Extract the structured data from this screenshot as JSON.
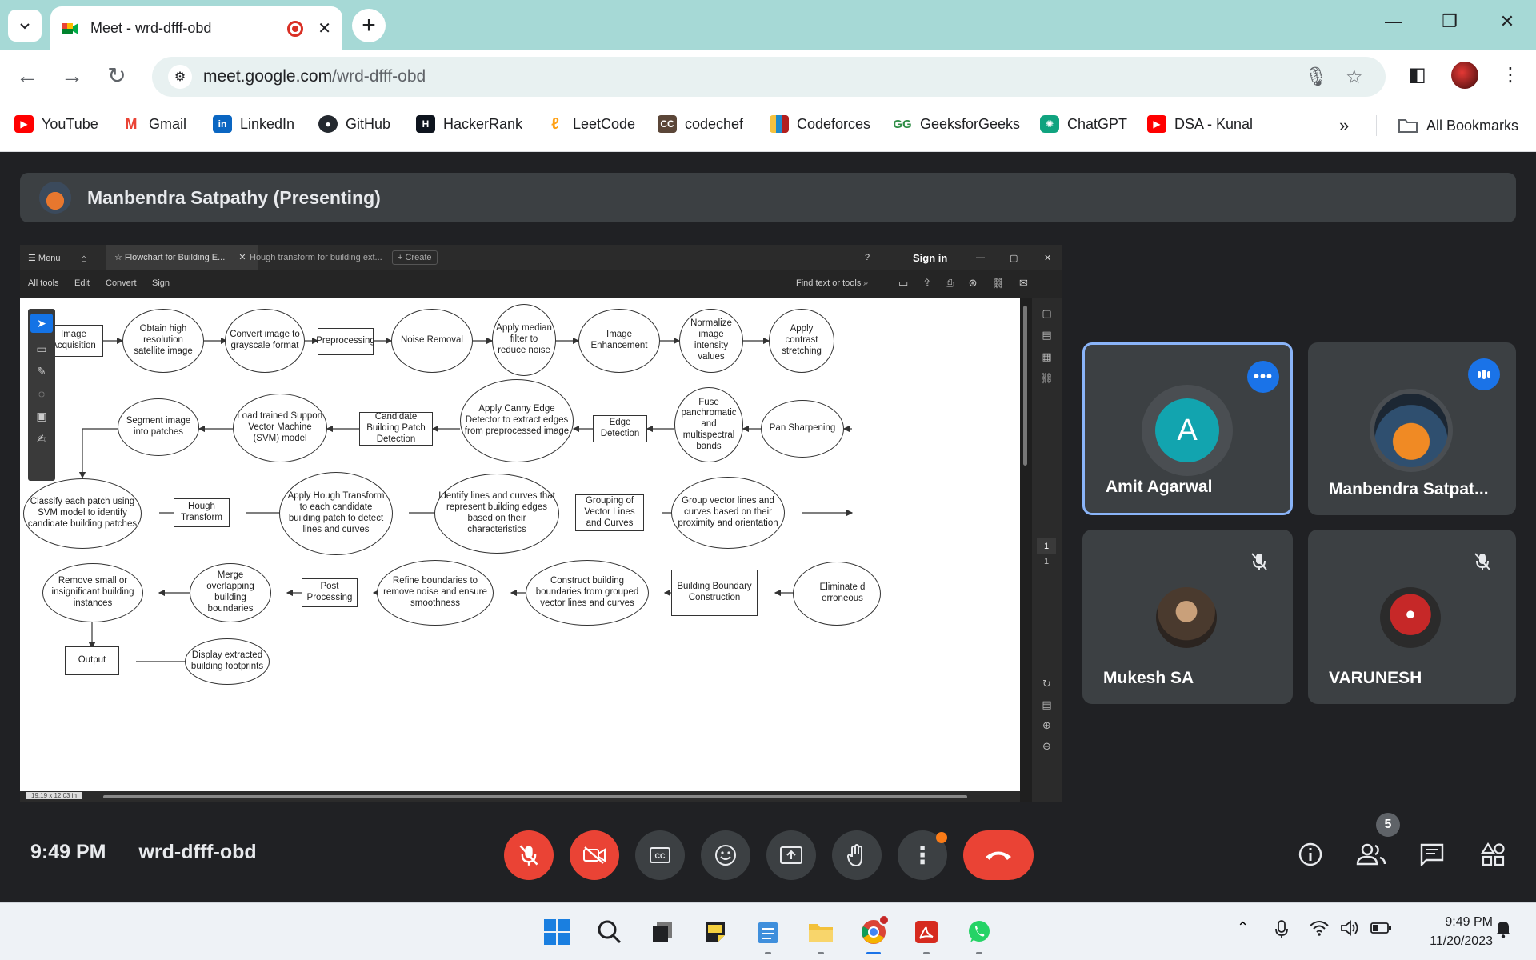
{
  "browser": {
    "tab_title": "Meet - wrd-dfff-obd",
    "url_host": "meet.google.com",
    "url_path": "/wrd-dfff-obd",
    "bookmarks": [
      {
        "label": "YouTube",
        "color": "#ff0000",
        "icon": "youtube-icon"
      },
      {
        "label": "Gmail",
        "color": "#ea4335",
        "icon": "gmail-icon"
      },
      {
        "label": "LinkedIn",
        "color": "#0a66c2",
        "icon": "linkedin-icon"
      },
      {
        "label": "GitHub",
        "color": "#24292f",
        "icon": "github-icon"
      },
      {
        "label": "HackerRank",
        "color": "#1ba94c",
        "icon": "hackerrank-icon"
      },
      {
        "label": "LeetCode",
        "color": "#ffa116",
        "icon": "leetcode-icon"
      },
      {
        "label": "codechef",
        "color": "#5b4638",
        "icon": "codechef-icon"
      },
      {
        "label": "Codeforces",
        "color": "#1f8acb",
        "icon": "codeforces-icon"
      },
      {
        "label": "GeeksforGeeks",
        "color": "#2f8d46",
        "icon": "geeksforgeeks-icon"
      },
      {
        "label": "ChatGPT",
        "color": "#10a37f",
        "icon": "chatgpt-icon"
      },
      {
        "label": "DSA - Kunal",
        "color": "#ff0000",
        "icon": "youtube-icon"
      }
    ],
    "all_bookmarks": "All Bookmarks"
  },
  "meet": {
    "presenter_label": "Manbendra Satpathy (Presenting)",
    "time": "9:49 PM",
    "meeting_code": "wrd-dfff-obd",
    "participant_count": "5",
    "participants": [
      {
        "name": "Amit Agarwal",
        "initial": "A",
        "avatar_color": "#12a4af",
        "speaking": true
      },
      {
        "name": "Manbendra Satpat...",
        "initial": "",
        "avatar_color": "#e8772e",
        "speaking": false
      },
      {
        "name": "Mukesh SA",
        "initial": "",
        "avatar_color": "#6b5a4e",
        "muted": true
      },
      {
        "name": "VARUNESH",
        "initial": "",
        "avatar_color": "#c62828",
        "muted": true
      }
    ],
    "colors": {
      "end_call": "#ea4335",
      "accent": "#1a73e8",
      "surface": "#3c4043"
    }
  },
  "shared_screen": {
    "app_tabs": [
      "Menu",
      "Flowchart for Building E...",
      "Hough transform for building ext...",
      "Create"
    ],
    "sign_in": "Sign in",
    "menu_items": [
      "All tools",
      "Edit",
      "Convert",
      "Sign"
    ],
    "find_placeholder": "Find text or tools",
    "page_size": "19.19 x 12.03 in",
    "page_numbers": [
      "1",
      "1"
    ],
    "flowchart": {
      "n1": "Image Acquisition",
      "n2": "Obtain high resolution satellite image",
      "n3": "Convert image to grayscale format",
      "n4": "Preprocessing",
      "n5": "Noise Removal",
      "n6": "Apply median filter to reduce noise",
      "n7": "Image Enhancement",
      "n8": "Normalize image intensity values",
      "n9": "Apply contrast stretching",
      "n10": "Pan Sharpening",
      "n11": "Fuse panchromatic and multispectral bands",
      "n12": "Edge Detection",
      "n13": "Apply Canny Edge Detector to extract edges from preprocessed image",
      "n14": "Candidate Building Patch Detection",
      "n15": "Load trained Support Vector Machine (SVM) model",
      "n16": "Segment image into patches",
      "n17": "Classify each patch using SVM model to identify candidate building patches",
      "n18": "Hough Transform",
      "n19": "Apply Hough Transform to each candidate building patch to detect lines and curves",
      "n20": "Identify lines and curves that represent building edges based on their characteristics",
      "n21": "Grouping of Vector Lines and Curves",
      "n22": "Group vector lines and curves based on their proximity and orientation",
      "n23": "Eliminate d erroneous",
      "n24": "Building Boundary Construction",
      "n25": "Construct building boundaries from grouped vector lines and curves",
      "n26": "Refine boundaries to remove noise and ensure smoothness",
      "n27": "Post Processing",
      "n28": "Merge overlapping building boundaries",
      "n29": "Remove small or insignificant building instances",
      "n30": "Output",
      "n31": "Display extracted building footprints"
    }
  },
  "taskbar": {
    "time": "9:49 PM",
    "date": "11/20/2023"
  }
}
